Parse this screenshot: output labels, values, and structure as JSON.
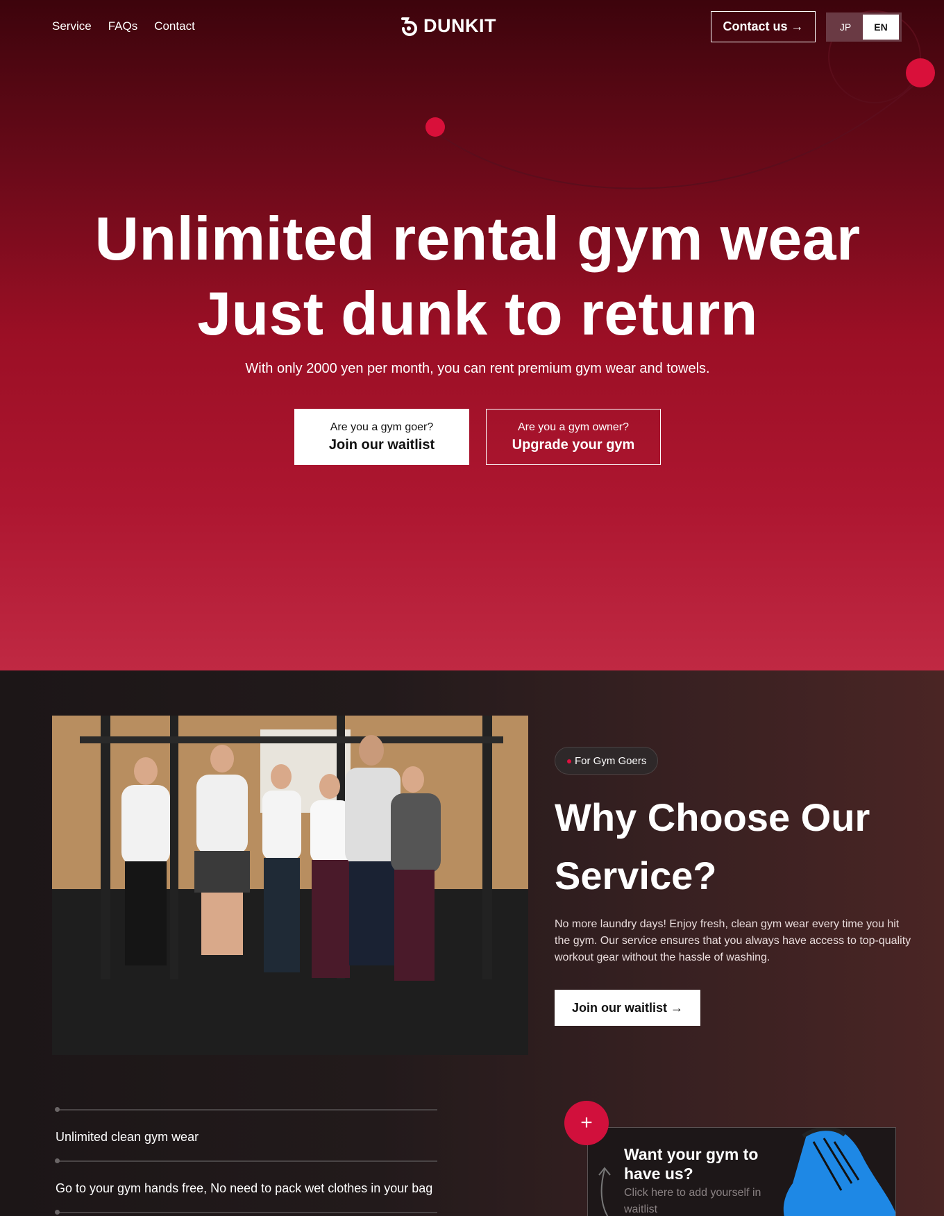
{
  "nav": {
    "links": [
      "Service",
      "FAQs",
      "Contact"
    ],
    "logo": "DUNKIT",
    "contact_button": "Contact us →",
    "languages": [
      "JP",
      "EN"
    ],
    "active_language": "EN"
  },
  "hero": {
    "title_line1": "Unlimited rental gym wear",
    "title_line2": "Just dunk to return",
    "subtitle": "With only 2000 yen per month, you can rent premium gym wear and towels.",
    "cta_goer": {
      "small": "Are you a gym goer?",
      "big": "Join our waitlist"
    },
    "cta_owner": {
      "small": "Are you a gym owner?",
      "big": "Upgrade your gym"
    }
  },
  "why": {
    "badge": "For Gym Goers",
    "title": "Why Choose Our Service?",
    "description": "No more laundry days! Enjoy fresh, clean gym wear every time you hit the gym. Our service ensures that you always have access to top-quality workout gear without the hassle of washing.",
    "button": "Join our waitlist →"
  },
  "features": [
    "Unlimited clean gym wear",
    "Go to your gym hands free, No need to pack wet clothes in your bag"
  ],
  "gym_card": {
    "title": "Want your gym to have us?",
    "subtitle": "Click here to add yourself in waitlist",
    "plus": "+"
  },
  "colors": {
    "accent": "#d1103c",
    "hero_top": "#3d040c",
    "hero_bottom": "#c02943",
    "dark_bg": "#1d1718"
  }
}
